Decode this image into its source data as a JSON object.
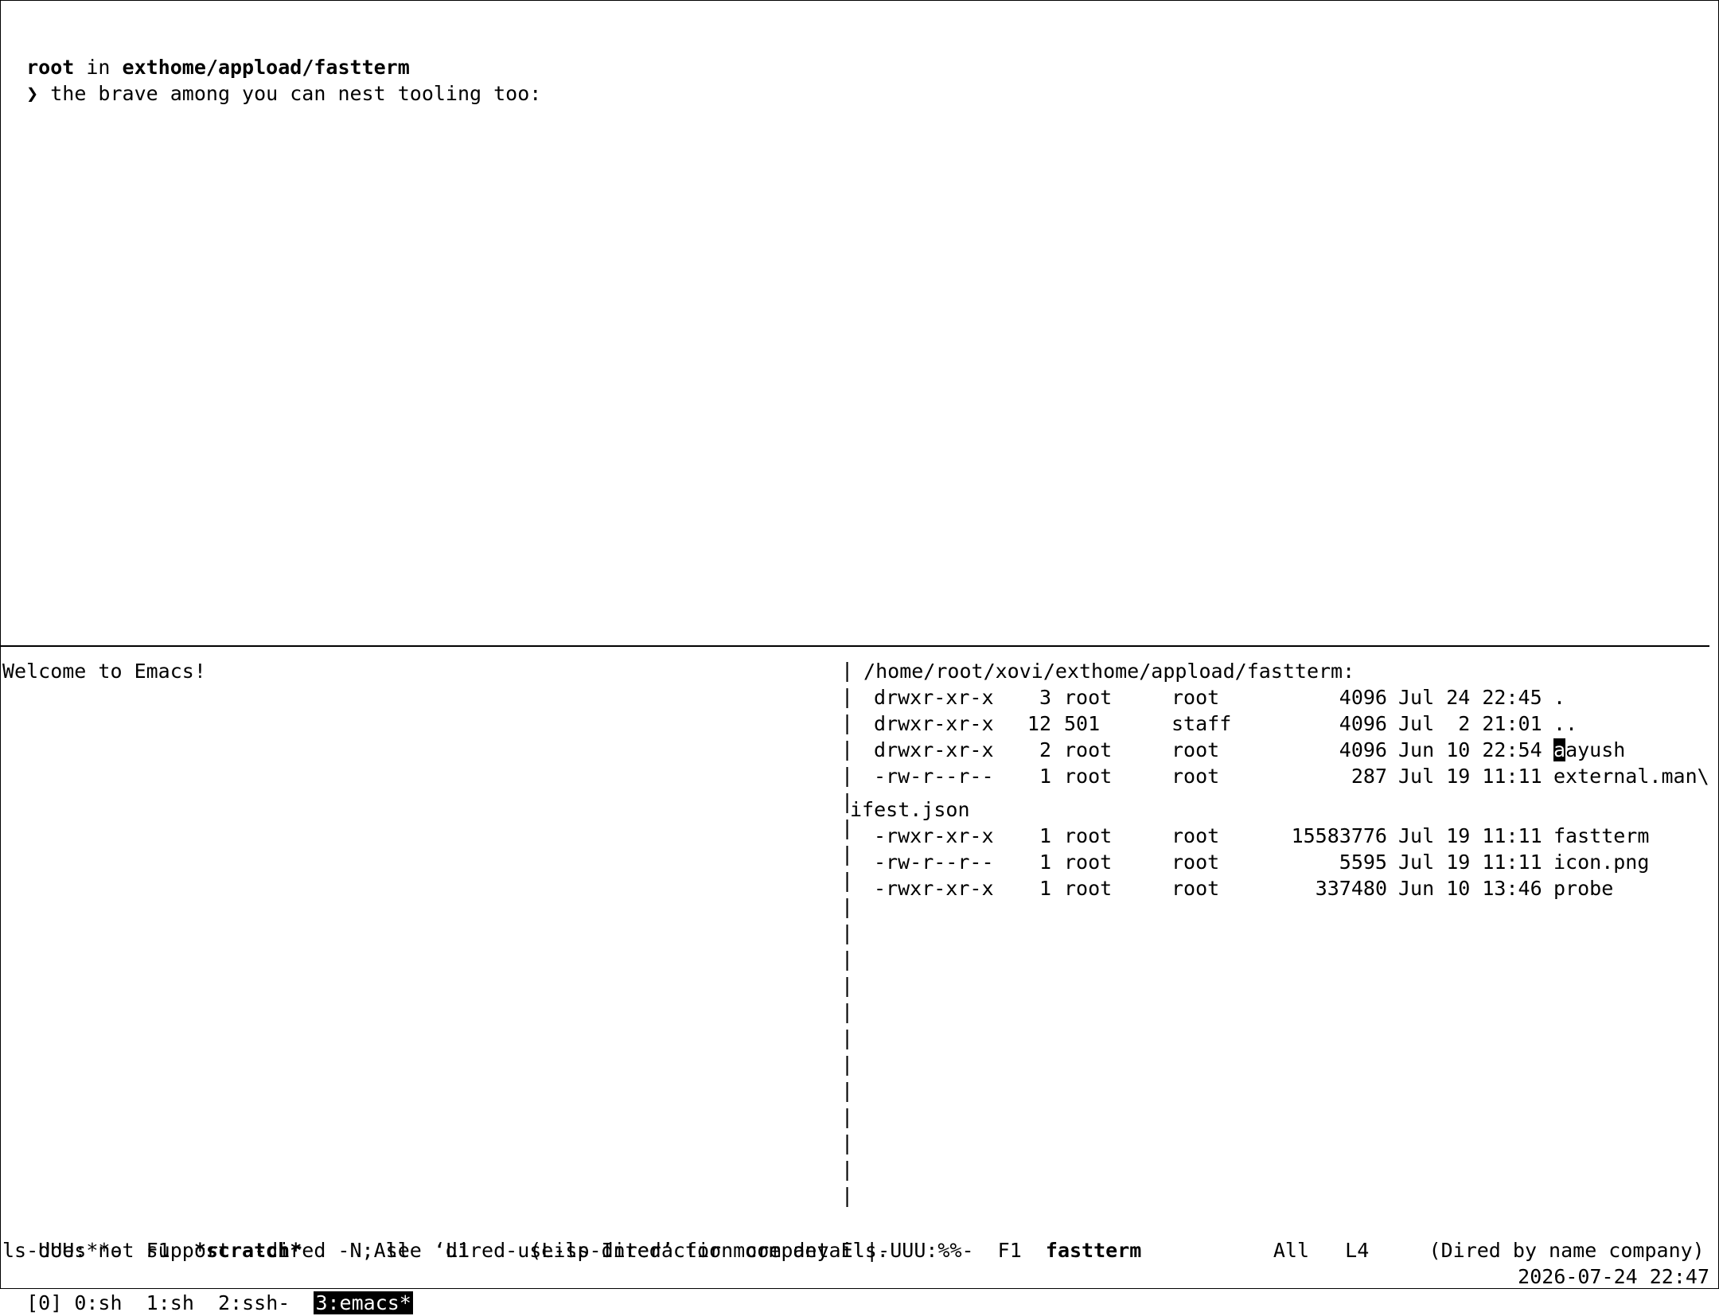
{
  "top_pane": {
    "prompt_user": "root",
    "prompt_in": " in ",
    "prompt_path": "exthome/appload/fastterm",
    "prompt_symbol": "❯",
    "command_text": " the brave among you can nest tooling too:"
  },
  "left_window": {
    "welcome": "Welcome to Emacs!",
    "modeline": {
      "flags": "-UUU:**-  F1  ",
      "buffer": "*scratch*",
      "position": "      All   L1     (Lisp Interaction company El"
    }
  },
  "right_window": {
    "header": " /home/root/xovi/exthome/appload/fastterm:",
    "entries": [
      {
        "perms": "drwxr-xr-x",
        "links": "3",
        "owner": "root",
        "group": "root",
        "size": "4096",
        "date": "Jul 24 22:45",
        "name": "."
      },
      {
        "perms": "drwxr-xr-x",
        "links": "12",
        "owner": "501",
        "group": "staff",
        "size": "4096",
        "date": "Jul  2 21:01",
        "name": ".."
      },
      {
        "perms": "drwxr-xr-x",
        "links": "2",
        "owner": "root",
        "group": "root",
        "size": "4096",
        "date": "Jun 10 22:54",
        "name_cursor": "a",
        "name": "ayush"
      },
      {
        "perms": "-rw-r--r--",
        "links": "1",
        "owner": "root",
        "group": "root",
        "size": "287",
        "date": "Jul 19 11:11",
        "name": "external.man\\"
      },
      {
        "perms": "-rwxr-xr-x",
        "links": "1",
        "owner": "root",
        "group": "root",
        "size": "15583776",
        "date": "Jul 19 11:11",
        "name": "fastterm"
      },
      {
        "perms": "-rw-r--r--",
        "links": "1",
        "owner": "root",
        "group": "root",
        "size": "5595",
        "date": "Jul 19 11:11",
        "name": "icon.png"
      },
      {
        "perms": "-rwxr-xr-x",
        "links": "1",
        "owner": "root",
        "group": "root",
        "size": "337480",
        "date": "Jun 10 13:46",
        "name": "probe"
      }
    ],
    "wrap_continuation": "ifest.json",
    "modeline": {
      "flags": "-UUU:%%-  F1  ",
      "buffer": "fastterm",
      "position": "           All   L4     (Dired by name company) -"
    }
  },
  "echo_area": "ls does not support --dired -N; see ‘dired-use-ls-dired’ for more details.",
  "tmux": {
    "session": "[0]",
    "windows": [
      {
        "label": "0:sh",
        "active": false
      },
      {
        "label": "1:sh",
        "active": false
      },
      {
        "label": "2:ssh-",
        "active": false
      },
      {
        "label": "3:emacs*",
        "active": true
      }
    ],
    "clock": "2026-07-24 22:47"
  }
}
